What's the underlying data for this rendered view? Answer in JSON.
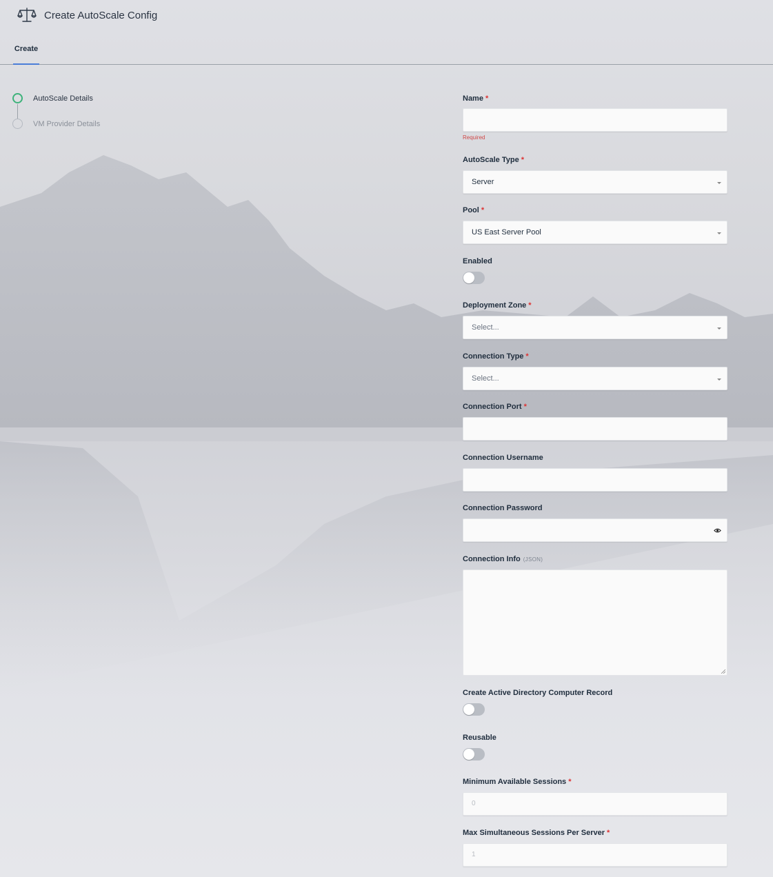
{
  "header": {
    "title": "Create AutoScale Config",
    "icon": "balance-scale-icon"
  },
  "tabs": [
    {
      "label": "Create",
      "active": true
    }
  ],
  "steps": [
    {
      "label": "AutoScale Details",
      "active": true
    },
    {
      "label": "VM Provider Details",
      "active": false
    }
  ],
  "form": {
    "name": {
      "label": "Name",
      "required_mark": "*",
      "value": "",
      "error": "Required"
    },
    "autoscale_type": {
      "label": "AutoScale Type",
      "required_mark": "*",
      "value": "Server"
    },
    "pool": {
      "label": "Pool",
      "required_mark": "*",
      "value": "US East Server Pool"
    },
    "enabled": {
      "label": "Enabled",
      "checked": false
    },
    "deployment_zone": {
      "label": "Deployment Zone",
      "required_mark": "*",
      "placeholder": "Select..."
    },
    "connection_type": {
      "label": "Connection Type",
      "required_mark": "*",
      "placeholder": "Select..."
    },
    "connection_port": {
      "label": "Connection Port",
      "required_mark": "*",
      "value": ""
    },
    "connection_username": {
      "label": "Connection Username",
      "value": ""
    },
    "connection_password": {
      "label": "Connection Password",
      "value": "",
      "icon": "eye-icon"
    },
    "connection_info": {
      "label": "Connection Info",
      "hint": "(JSON)",
      "value": ""
    },
    "create_ad_record": {
      "label": "Create Active Directory Computer Record",
      "checked": false
    },
    "reusable": {
      "label": "Reusable",
      "checked": false
    },
    "min_available_sessions": {
      "label": "Minimum Available Sessions",
      "required_mark": "*",
      "placeholder": "0"
    },
    "max_simultaneous_sessions": {
      "label": "Max Simultaneous Sessions Per Server",
      "required_mark": "*",
      "placeholder": "1"
    }
  },
  "colors": {
    "accent": "#4a7dd8",
    "step_active": "#3db27a",
    "required": "#dd3333",
    "error_text": "#d04848",
    "toggle_off": "#b9bdc4"
  }
}
